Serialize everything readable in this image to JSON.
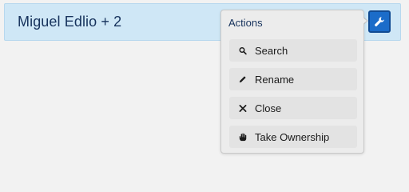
{
  "header": {
    "title": "Miguel Edlio + 2"
  },
  "toolbar": {
    "actions_icon": "wrench-icon"
  },
  "popover": {
    "title": "Actions",
    "items": [
      {
        "label": "Search",
        "icon": "search-icon"
      },
      {
        "label": "Rename",
        "icon": "pencil-icon"
      },
      {
        "label": "Close",
        "icon": "close-icon"
      },
      {
        "label": "Take Ownership",
        "icon": "hand-icon"
      }
    ]
  },
  "colors": {
    "header_background": "#cfe7f6",
    "button_blue": "#1b6cc9",
    "title_text": "#16325c"
  }
}
